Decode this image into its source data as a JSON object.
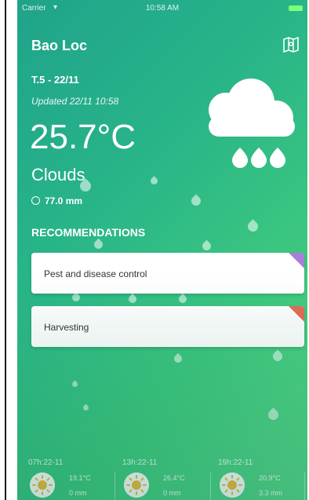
{
  "status_bar": {
    "carrier": "Carrier",
    "time": "10:58 AM"
  },
  "location": {
    "city": "Bao Loc"
  },
  "current": {
    "date": "T.5 - 22/11",
    "updated": "Updated 22/11 10:58",
    "temperature": "25.7°C",
    "condition": "Clouds",
    "rain": "77.0 mm"
  },
  "recommendations": {
    "title": "RECOMMENDATIONS",
    "items": [
      {
        "label": "Pest and disease control",
        "accent": "#a97fd9"
      },
      {
        "label": "Harvesting",
        "accent": "#e86a55"
      }
    ]
  },
  "forecast": [
    {
      "time": "07h:22-11",
      "temp": "19.1°C",
      "rain": "0 mm",
      "icon": "sun-icon"
    },
    {
      "time": "13h:22-11",
      "temp": "26.4°C",
      "rain": "0 mm",
      "icon": "sun-icon"
    },
    {
      "time": "19h:22-11",
      "temp": "20.9°C",
      "rain": "3.3 mm",
      "icon": "sun-icon"
    }
  ],
  "colors": {
    "gradient_start": "#1fa38a",
    "gradient_end": "#5bd98a",
    "card_background": "#ffffff"
  }
}
